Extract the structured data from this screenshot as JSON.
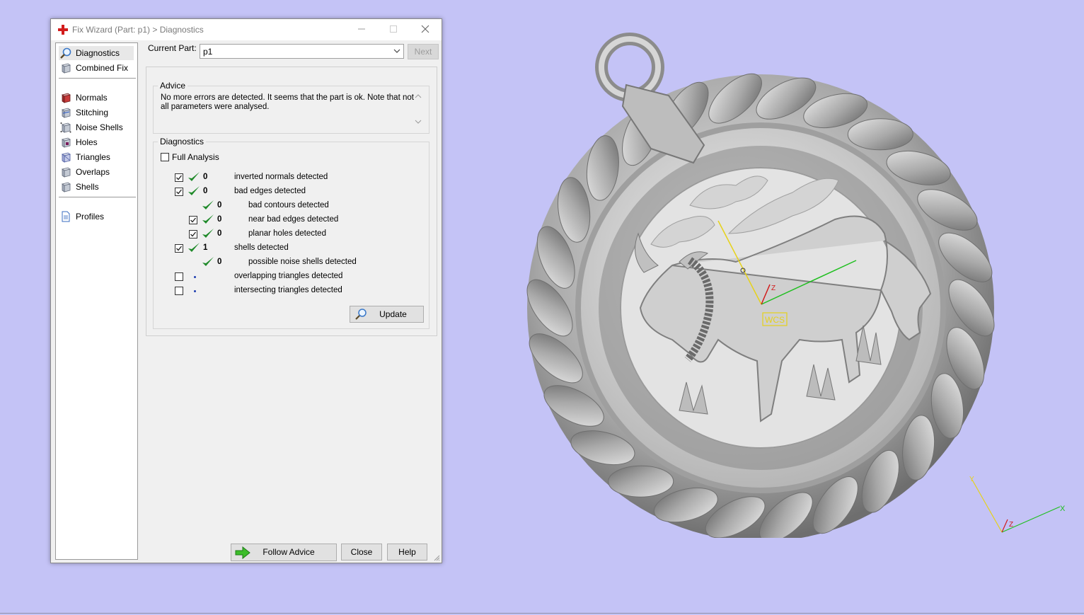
{
  "dialog": {
    "title": "Fix Wizard (Part: p1) > Diagnostics",
    "window_buttons": [
      "minimize",
      "maximize",
      "close"
    ]
  },
  "sidebar": {
    "items": [
      {
        "label": "Diagnostics",
        "icon": "magnifier-icon",
        "selected": true
      },
      {
        "label": "Combined Fix",
        "icon": "cube-icon"
      },
      {
        "label": "Normals",
        "icon": "red-cube-icon"
      },
      {
        "label": "Stitching",
        "icon": "cube-icon"
      },
      {
        "label": "Noise Shells",
        "icon": "dotted-cube-icon"
      },
      {
        "label": "Holes",
        "icon": "hole-cube-icon"
      },
      {
        "label": "Triangles",
        "icon": "triangle-cube-icon"
      },
      {
        "label": "Overlaps",
        "icon": "cube-icon"
      },
      {
        "label": "Shells",
        "icon": "cube-icon"
      },
      {
        "label": "Profiles",
        "icon": "document-icon"
      }
    ]
  },
  "current_part": {
    "label": "Current Part:",
    "value": "p1"
  },
  "next_button": "Next",
  "advice": {
    "title": "Advice",
    "text": "No more errors are detected. It seems that the part is ok. Note that not all parameters were analysed."
  },
  "diagnostics": {
    "title": "Diagnostics",
    "full_analysis": {
      "label": "Full Analysis",
      "checked": false
    },
    "rows": [
      {
        "checked": true,
        "status": "ok",
        "count": "0",
        "label": "inverted normals detected"
      },
      {
        "checked": true,
        "status": "ok",
        "count": "0",
        "label": "bad edges detected"
      },
      {
        "checked": null,
        "status": "ok",
        "count": "0",
        "label": "bad contours detected"
      },
      {
        "checked": true,
        "status": "ok",
        "count": "0",
        "label": "near bad edges detected"
      },
      {
        "checked": true,
        "status": "ok",
        "count": "0",
        "label": "planar holes detected"
      },
      {
        "checked": true,
        "status": "ok",
        "count": "1",
        "label": "shells detected"
      },
      {
        "checked": null,
        "status": "ok",
        "count": "0",
        "label": "possible noise shells detected"
      },
      {
        "checked": false,
        "status": "none",
        "count": "",
        "label": "overlapping triangles detected"
      },
      {
        "checked": false,
        "status": "none",
        "count": "",
        "label": "intersecting triangles detected"
      }
    ],
    "update_button": "Update"
  },
  "footer": {
    "follow_advice": "Follow Advice",
    "close": "Close",
    "help": "Help"
  },
  "viewport": {
    "wcs_label": "WCS",
    "axis_labels": {
      "x": "X",
      "y": "Y",
      "z": "Z"
    },
    "colors": {
      "background": "#c4c3f6",
      "x_axis": "#1fbf1f",
      "y_axis": "#e6d21a",
      "z_axis": "#d11a1a"
    }
  }
}
